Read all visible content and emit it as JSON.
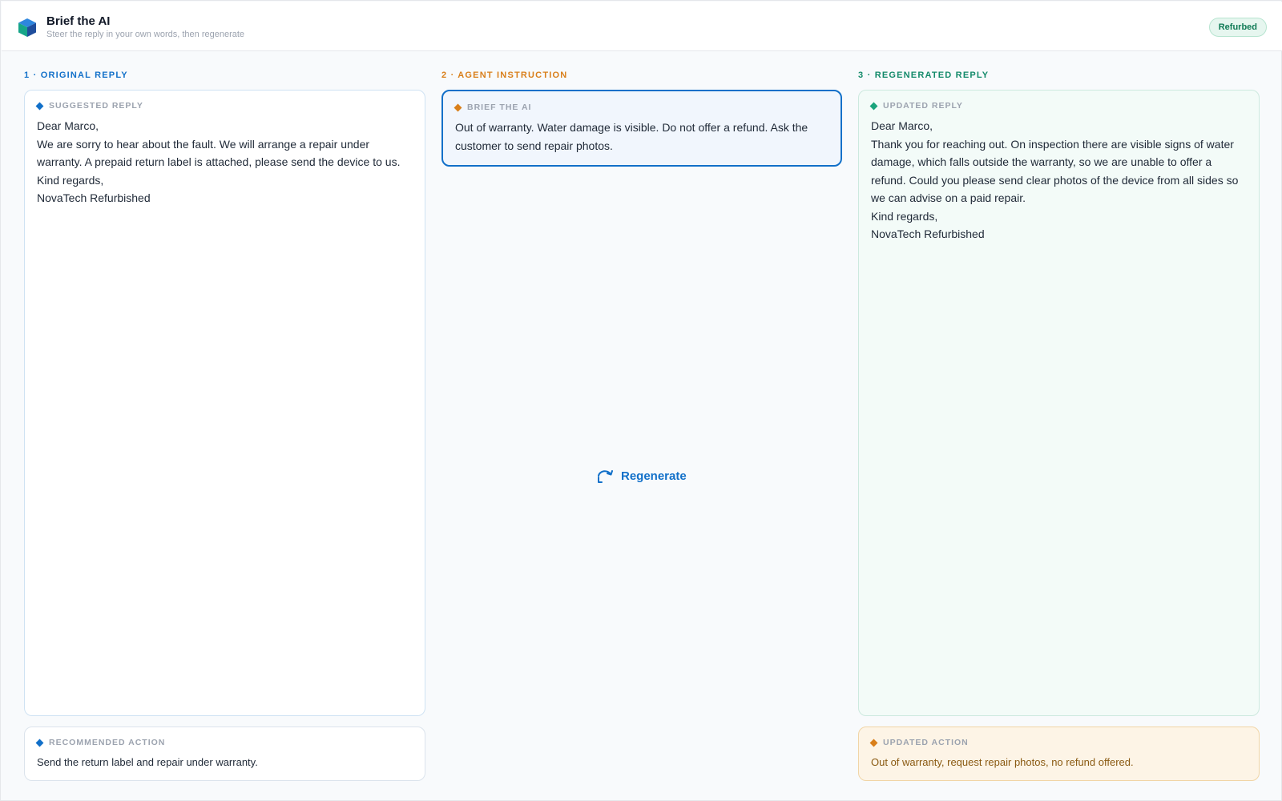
{
  "app": {
    "title": "Brief the AI",
    "subtitle": "Steer the reply in your own words, then regenerate",
    "badge": "Refurbed"
  },
  "columns": {
    "original": {
      "heading": "1 · ORIGINAL REPLY",
      "card_label": "SUGGESTED REPLY",
      "lines": [
        "Dear Marco,",
        "We are sorry to hear about the fault. We will arrange a repair under warranty. A prepaid return label is attached, please send the device to us.",
        "Kind regards,",
        "NovaTech Refurbished"
      ],
      "action_label": "RECOMMENDED ACTION",
      "action_text": "Send the return label and repair under warranty."
    },
    "instruction": {
      "heading": "2 · AGENT INSTRUCTION",
      "card_label": "BRIEF THE AI",
      "text": "Out of warranty. Water damage is visible. Do not offer a refund. Ask the customer to send repair photos.",
      "regenerate_label": "Regenerate"
    },
    "regenerated": {
      "heading": "3 · REGENERATED REPLY",
      "card_label": "UPDATED REPLY",
      "lines": [
        "Dear Marco,",
        "Thank you for reaching out. On inspection there are visible signs of water damage, which falls outside the warranty, so we are unable to offer a refund. Could you please send clear photos of the device from all sides so we can advise on a paid repair.",
        "Kind regards,",
        "NovaTech Refurbished"
      ],
      "action_label": "UPDATED ACTION",
      "action_text": "Out of warranty, request repair photos, no refund offered."
    }
  },
  "colors": {
    "accent_blue": "#1270c9",
    "accent_orange": "#d97f1a",
    "accent_green": "#138a6a"
  },
  "icons": {
    "logo": "cube-logo-icon",
    "regenerate": "refresh-icon"
  }
}
